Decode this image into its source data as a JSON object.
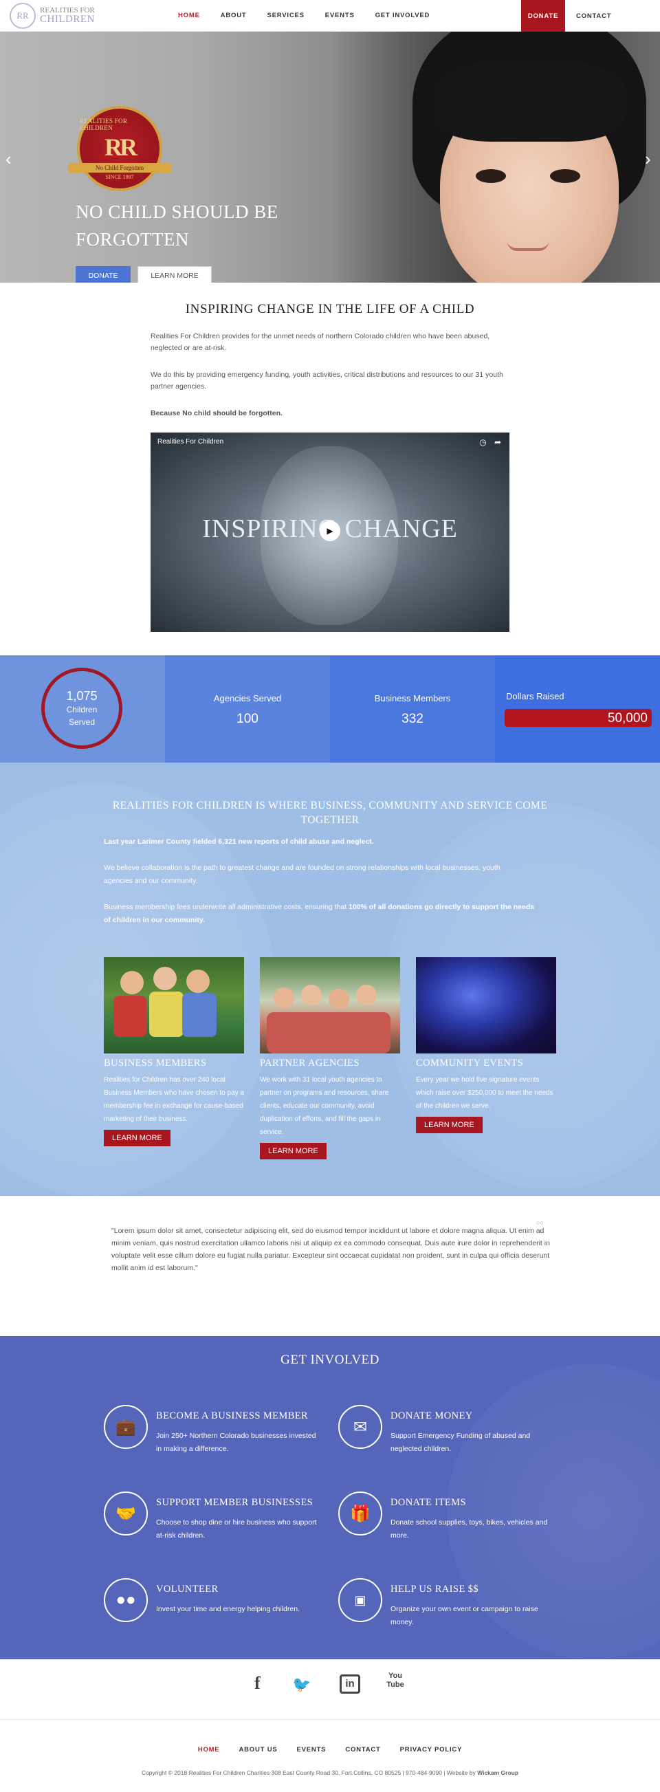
{
  "nav": {
    "logo_top": "REALITIES FOR",
    "logo_bottom": "CHILDREN",
    "logo_mark": "RR",
    "items": [
      "HOME",
      "ABOUT",
      "SERVICES",
      "EVENTS",
      "GET INVOLVED"
    ],
    "donate": "DONATE",
    "contact": "CONTACT"
  },
  "hero": {
    "badge_top": "REALITIES FOR CHILDREN",
    "badge_mark": "RR",
    "badge_ribbon": "No Child Forgotten",
    "badge_since": "SINCE 1997",
    "title": "NO CHILD SHOULD BE FORGOTTEN",
    "donate": "DONATE",
    "learn": "LEARN MORE"
  },
  "intro": {
    "title": "INSPIRING CHANGE IN THE LIFE OF A CHILD",
    "p1": "Realities For Children provides for the unmet needs of northern Colorado children who have been abused, neglected or are at-risk.",
    "p2": "We do this by providing emergency funding, youth activities, critical distributions and resources to our 31 youth partner agencies.",
    "p3": "Because No child should be forgotten.",
    "video_title": "Realities For Children",
    "video_caption": "INSPIRING CHANGE"
  },
  "stats": {
    "children_value": "1,075",
    "children_label": "Children Served",
    "agencies_label": "Agencies Served",
    "agencies_value": "100",
    "members_label": "Business Members",
    "members_value": "332",
    "dollars_label": "Dollars Raised",
    "dollars_value": "50,000"
  },
  "community": {
    "title": "REALITIES FOR CHILDREN IS WHERE BUSINESS, COMMUNITY AND SERVICE COME TOGETHER",
    "p1": "Last year Larimer County fielded 6,321 new reports of child abuse and neglect.",
    "p2": "We believe collaboration is the path to greatest change and are founded on strong relationships with local businesses, youth agencies and our community.",
    "p3_start": "Business membership fees underwrite all administrative costs, ensuring that ",
    "p3_bold": "100% of all donations go directly to support the needs of children in our community.",
    "cards": [
      {
        "title": "BUSINESS MEMBERS",
        "text": "Realities for Children has over 240 local Business Members who have chosen to pay a membership fee in exchange for cause-based marketing of their business.",
        "button": "LEARN MORE"
      },
      {
        "title": "PARTNER AGENCIES",
        "text": "We work with 31 local youth agencies to partner on programs and resources, share clients, educate our community, avoid duplication of efforts, and fill the gaps in service.",
        "button": "LEARN MORE"
      },
      {
        "title": "COMMUNITY EVENTS",
        "text": "Every year we hold five signature events which raise over $250,000 to meet the needs of the children we serve.",
        "button": "LEARN MORE"
      }
    ]
  },
  "quote": {
    "text": "\"Lorem ipsum dolor sit amet, consectetur adipiscing elit, sed do eiusmod tempor incididunt ut labore et dolore magna aliqua. Ut enim ad minim veniam, quis nostrud exercitation ullamco laboris nisi ut aliquip ex ea commodo consequat. Duis aute irure dolor in reprehenderit in voluptate velit esse cillum dolore eu fugiat nulla pariatur. Excepteur sint occaecat cupidatat non proident, sunt in culpa qui officia deserunt mollit anim id est laborum.\""
  },
  "involved": {
    "title": "GET INVOLVED",
    "items": [
      {
        "title": "BECOME A BUSINESS MEMBER",
        "text": "Join 250+ Northern Colorado businesses invested in making a difference.",
        "icon": "briefcase-icon"
      },
      {
        "title": "DONATE MONEY",
        "text": "Support Emergency Funding of abused and neglected children.",
        "icon": "envelope-icon"
      },
      {
        "title": "SUPPORT MEMBER BUSINESSES",
        "text": "Choose to shop dine or hire business who support at-risk children.",
        "icon": "handshake-icon"
      },
      {
        "title": "DONATE ITEMS",
        "text": "Donate school supplies, toys, bikes, vehicles and more.",
        "icon": "gift-icon"
      },
      {
        "title": "VOLUNTEER",
        "text": "Invest your time and energy helping children.",
        "icon": "people-icon"
      },
      {
        "title": "HELP US RAISE $$",
        "text": "Organize your own event or campaign to raise money.",
        "icon": "money-icon"
      }
    ]
  },
  "social": {
    "facebook": "f",
    "linkedin": "in",
    "youtube": "You Tube"
  },
  "footer": {
    "links": [
      "HOME",
      "ABOUT US",
      "EVENTS",
      "CONTACT",
      "PRIVACY POLICY"
    ],
    "copyright": "Copyright © 2018 Realities For Children Charities 308 East County Road 30, Fort Collins, CO 80525 | 970-484-9090 | Website by ",
    "credit": "Wickam Group"
  }
}
